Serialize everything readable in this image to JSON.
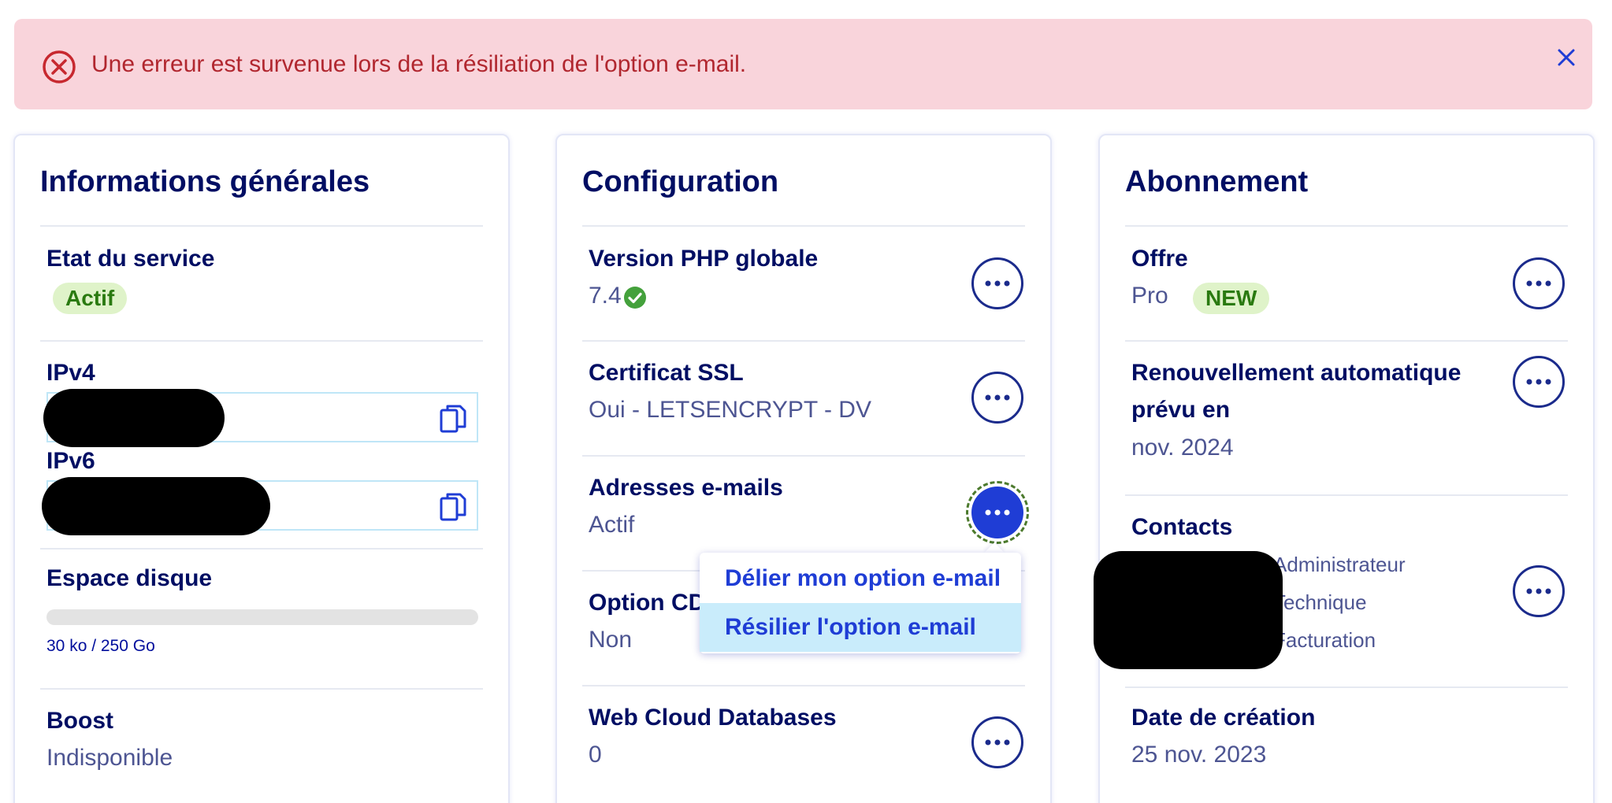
{
  "alert": {
    "message": "Une erreur est survenue lors de la résiliation de l'option e-mail.",
    "color": "#b1272f",
    "background": "#f9d4db"
  },
  "general": {
    "title": "Informations générales",
    "service_state_label": "Etat du service",
    "service_state_value": "Actif",
    "ipv4_label": "IPv4",
    "ipv6_label": "IPv6",
    "disk_label": "Espace disque",
    "disk_usage": "30 ko / 250 Go",
    "disk_fill_fraction": 0.0001,
    "boost_label": "Boost",
    "boost_value": "Indisponible"
  },
  "config": {
    "title": "Configuration",
    "php_label": "Version PHP globale",
    "php_value": "7.4",
    "ssl_label": "Certificat SSL",
    "ssl_value": "Oui - LETSENCRYPT - DV",
    "emails_label": "Adresses e-mails",
    "emails_value": "Actif",
    "cdn_label": "Option CDN",
    "cdn_value": "Non",
    "db_label": "Web Cloud Databases",
    "db_value": "0"
  },
  "dropdown": {
    "items": [
      "Délier mon option e-mail",
      "Résilier l'option e-mail"
    ]
  },
  "subscription": {
    "title": "Abonnement",
    "offer_label": "Offre",
    "offer_value": "Pro",
    "offer_badge": "NEW",
    "renewal_label_line1": "Renouvellement automatique",
    "renewal_label_line2": "prévu en",
    "renewal_value": "nov. 2024",
    "contacts_label": "Contacts",
    "contact_roles": [
      "Administrateur",
      "Technique",
      "Facturation"
    ],
    "creation_label": "Date de création",
    "creation_value": "25 nov. 2023"
  },
  "icons": {
    "error": "error-circle-icon",
    "close": "close-icon",
    "copy": "copy-icon",
    "check": "check-circle-icon",
    "more": "more-options-icon"
  },
  "colors": {
    "primary": "#000e9c",
    "accent": "#1f3dd5",
    "success": "#44a13c",
    "badge_bg": "#dff3c9"
  }
}
